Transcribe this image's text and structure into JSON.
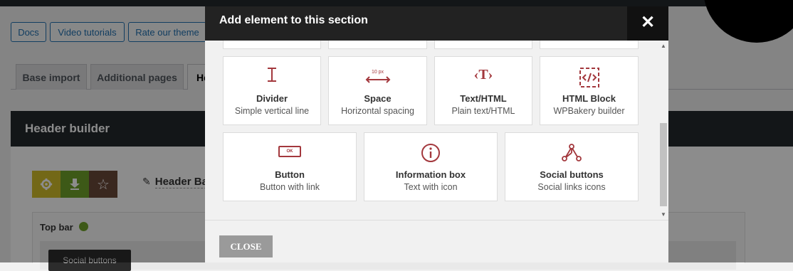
{
  "background": {
    "top_buttons": [
      {
        "label": "Docs"
      },
      {
        "label": "Video tutorials"
      },
      {
        "label": "Rate our theme"
      }
    ],
    "tabs": [
      {
        "label": "Base import"
      },
      {
        "label": "Additional pages"
      },
      {
        "label": "He"
      }
    ],
    "header_builder": {
      "title": "Header builder",
      "header_name": "Header Bas",
      "top_bar_label": "Top bar",
      "social_chip": "Social buttons"
    },
    "colors": {
      "gear_button": "#d1be2a",
      "download_button": "#6fa32a",
      "star_button": "#6b4a3a"
    }
  },
  "modal": {
    "title": "Add element to this section",
    "close_icon": "close-icon",
    "close_button": "CLOSE",
    "accent_color": "#a3383d",
    "elements_row1": [
      {
        "name": "Divider",
        "desc": "Simple vertical line",
        "icon": "divider-icon"
      },
      {
        "name": "Space",
        "desc": "Horizontal spacing",
        "icon": "space-icon",
        "icon_text": "10 px"
      },
      {
        "name": "Text/HTML",
        "desc": "Plain text/HTML",
        "icon": "text-html-icon",
        "icon_text": "‹T›"
      },
      {
        "name": "HTML Block",
        "desc": "WPBakery builder",
        "icon": "html-block-icon"
      }
    ],
    "elements_row2": [
      {
        "name": "Button",
        "desc": "Button with link",
        "icon": "button-icon",
        "icon_text": "OK"
      },
      {
        "name": "Information box",
        "desc": "Text with icon",
        "icon": "info-icon"
      },
      {
        "name": "Social buttons",
        "desc": "Social links icons",
        "icon": "share-icon"
      }
    ]
  }
}
